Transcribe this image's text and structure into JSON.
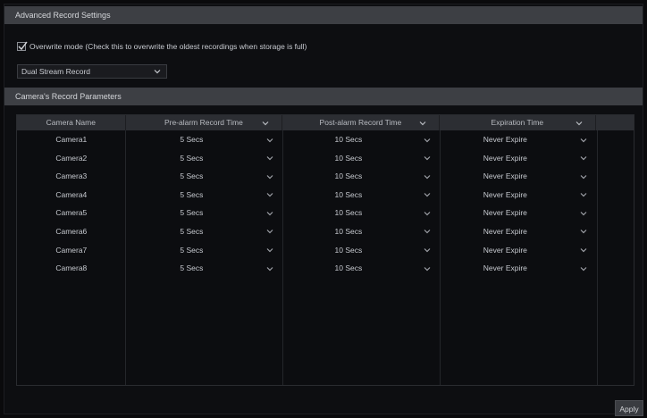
{
  "advanced_settings": {
    "header": "Advanced Record Settings",
    "overwrite_label": "Overwrite mode (Check this to overwrite the oldest recordings when storage is full)",
    "overwrite_checked": true,
    "record_mode_value": "Dual Stream Record"
  },
  "camera_params": {
    "header": "Camera's Record Parameters",
    "columns": [
      "Camera Name",
      "Pre-alarm Record Time",
      "Post-alarm Record Time",
      "Expiration Time"
    ],
    "rows": [
      {
        "camera": "Camera1",
        "pre": "5 Secs",
        "post": "10 Secs",
        "expire": "Never Expire"
      },
      {
        "camera": "Camera2",
        "pre": "5 Secs",
        "post": "10 Secs",
        "expire": "Never Expire"
      },
      {
        "camera": "Camera3",
        "pre": "5 Secs",
        "post": "10 Secs",
        "expire": "Never Expire"
      },
      {
        "camera": "Camera4",
        "pre": "5 Secs",
        "post": "10 Secs",
        "expire": "Never Expire"
      },
      {
        "camera": "Camera5",
        "pre": "5 Secs",
        "post": "10 Secs",
        "expire": "Never Expire"
      },
      {
        "camera": "Camera6",
        "pre": "5 Secs",
        "post": "10 Secs",
        "expire": "Never Expire"
      },
      {
        "camera": "Camera7",
        "pre": "5 Secs",
        "post": "10 Secs",
        "expire": "Never Expire"
      },
      {
        "camera": "Camera8",
        "pre": "5 Secs",
        "post": "10 Secs",
        "expire": "Never Expire"
      }
    ]
  },
  "footer": {
    "apply_label": "Apply"
  },
  "icons": {
    "dropdown": "chevron-down-icon",
    "check": "checkmark-icon"
  },
  "colors": {
    "header_bg": "#3d3f44",
    "panel_bg": "#0d0e11",
    "text": "#c9ccd2"
  }
}
